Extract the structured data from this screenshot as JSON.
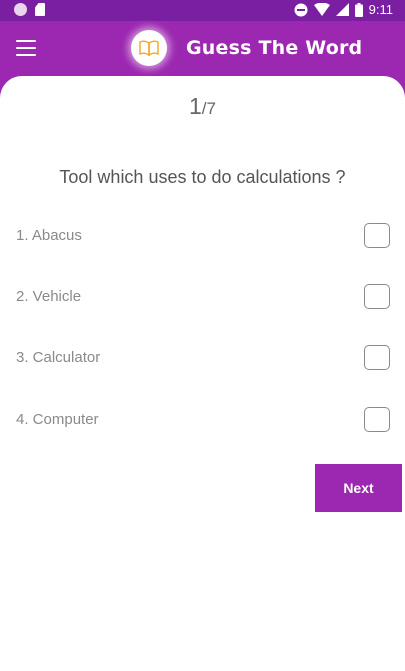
{
  "status_bar": {
    "time": "9:11",
    "icons": [
      "circle-notification-icon",
      "sd-card-icon",
      "do-not-disturb-icon",
      "wifi-icon",
      "signal-icon",
      "battery-icon"
    ]
  },
  "app_bar": {
    "title": "Guess The Word",
    "menu_icon": "hamburger-menu-icon",
    "logo_icon": "open-book-icon"
  },
  "quiz": {
    "current": "1",
    "total": "/7",
    "question": "Tool which uses to do calculations ?",
    "options": [
      {
        "label": "1. Abacus",
        "checked": false
      },
      {
        "label": "2. Vehicle",
        "checked": false
      },
      {
        "label": "3. Calculator",
        "checked": false
      },
      {
        "label": "4. Computer",
        "checked": false
      }
    ],
    "next_label": "Next"
  },
  "colors": {
    "primary": "#9c27b0",
    "primary_dark": "#7b1fa2",
    "logo_accent": "#f5a623"
  }
}
